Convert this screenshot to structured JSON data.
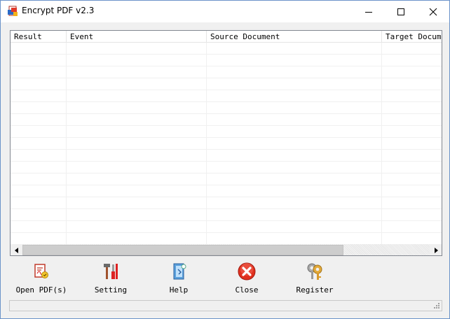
{
  "window": {
    "title": "Encrypt PDF v2.3"
  },
  "table": {
    "columns": [
      {
        "label": "Result"
      },
      {
        "label": "Event"
      },
      {
        "label": "Source Document"
      },
      {
        "label": "Target Document"
      }
    ],
    "rows": []
  },
  "toolbar": {
    "open_label": "Open PDF(s)",
    "setting_label": "Setting",
    "help_label": "Help",
    "close_label": "Close",
    "register_label": "Register"
  },
  "statusbar": {
    "text": ""
  },
  "colors": {
    "window_border": "#6b93c9",
    "close_red": "#e0301e"
  }
}
